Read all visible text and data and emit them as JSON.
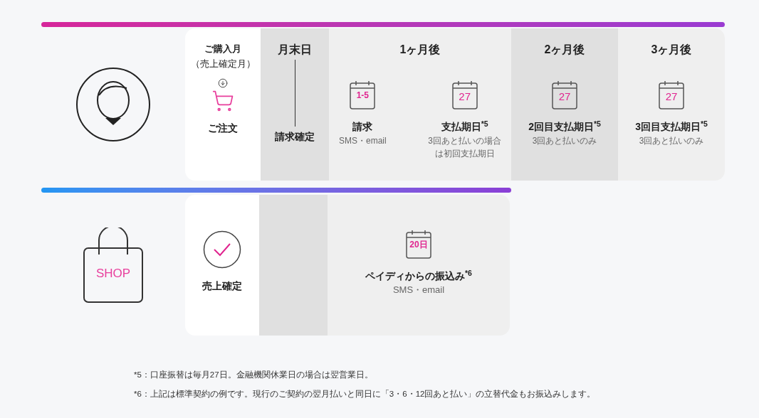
{
  "customer_timeline": {
    "columns": [
      {
        "kind": "order",
        "header_lines": [
          "ご購入月",
          "（売上確定月）"
        ],
        "label": "ご注文"
      },
      {
        "kind": "month_end",
        "header": "月末日",
        "label": "請求確定"
      },
      {
        "kind": "month",
        "header": "1ヶ月後",
        "events": [
          {
            "date": "1-5",
            "title": "請求",
            "note_lines": [
              "SMS・email"
            ]
          },
          {
            "date": "27",
            "title": "支払期日$^{*5}$",
            "note_lines": [
              "3回あと払いの場合",
              "は初回支払期日"
            ]
          }
        ]
      },
      {
        "kind": "month",
        "header": "2ヶ月後",
        "events": [
          {
            "date": "27",
            "title": "2回目支払期日$^{*5}$",
            "note_lines": [
              "3回あと払いのみ"
            ]
          }
        ]
      },
      {
        "kind": "month",
        "header": "3ヶ月後",
        "events": [
          {
            "date": "27",
            "title": "3回目支払期日$^{*5}$",
            "note_lines": [
              "3回あと払いのみ"
            ]
          }
        ]
      }
    ]
  },
  "shop_timeline": {
    "shop_label": "SHOP",
    "columns": [
      {
        "kind": "confirm",
        "label": "売上確定"
      },
      {
        "kind": "blank"
      },
      {
        "kind": "transfer",
        "date": "20日",
        "title": "ペイディからの振込み$^{*6}$",
        "note_lines": [
          "SMS・email"
        ]
      }
    ]
  },
  "footnotes": [
    "*5：口座振替は毎月27日。金融機関休業日の場合は翌営業日。",
    "*6：上記は標準契約の例です。現行のご契約の翌月払いと同日に「3・6・12回あと払い」の立替代金もお振込みします。"
  ]
}
